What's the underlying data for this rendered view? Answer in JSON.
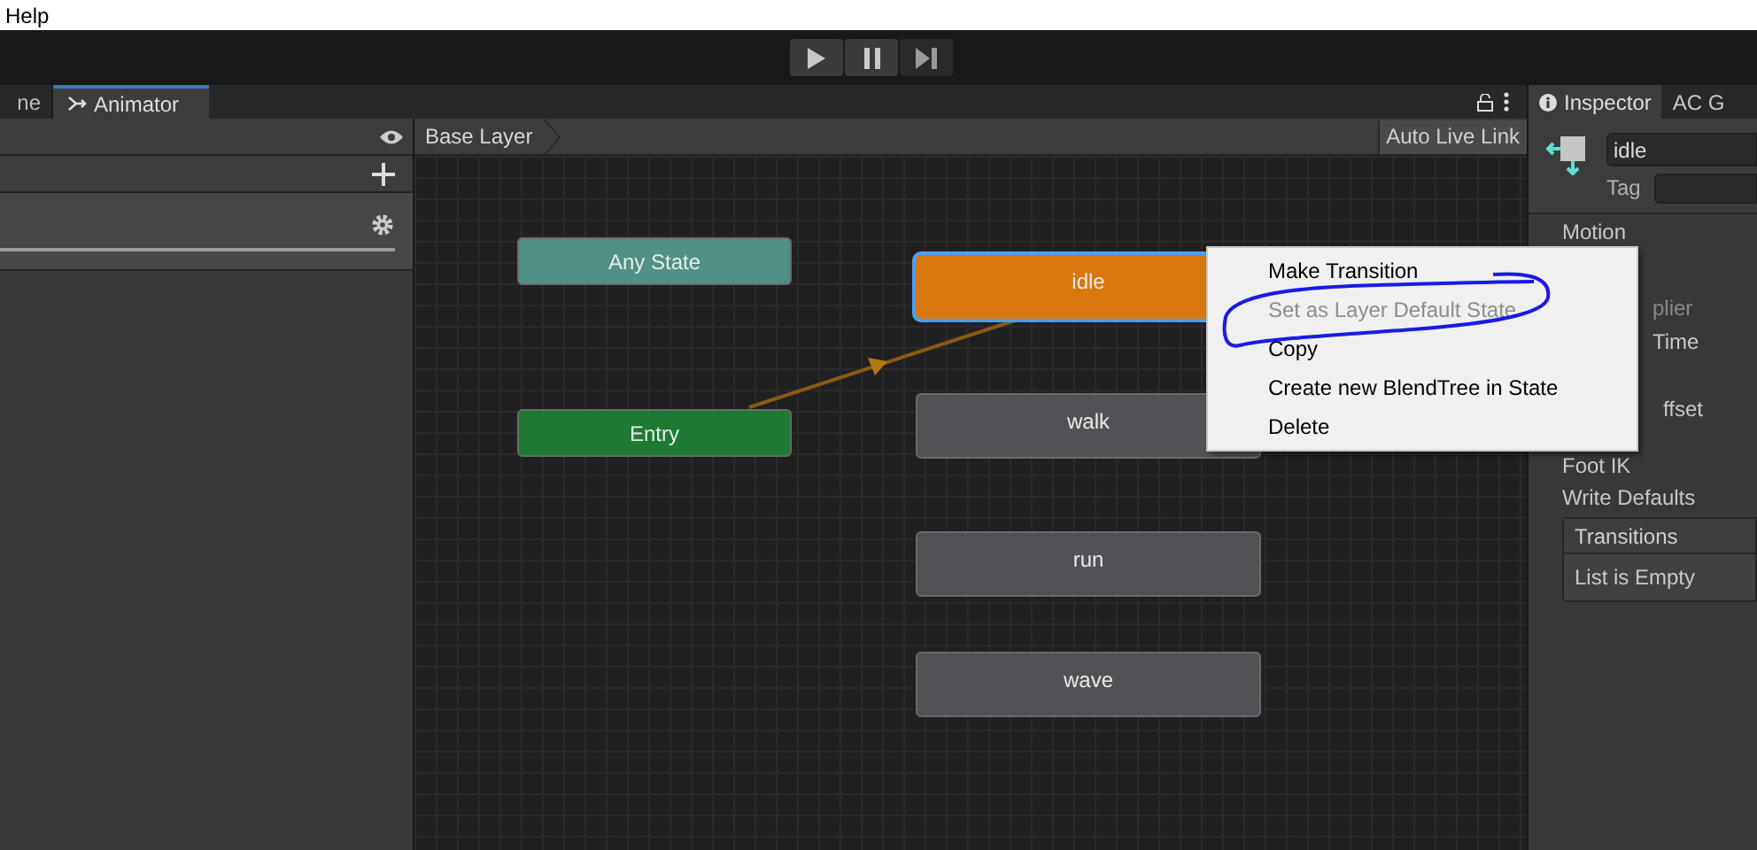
{
  "menu_bar": {
    "items": [
      "Help"
    ]
  },
  "toolbar": {
    "buttons": [
      {
        "kind": "play",
        "on": false
      },
      {
        "kind": "pause",
        "on": false
      },
      {
        "kind": "step",
        "on": false
      }
    ]
  },
  "tabs": [
    {
      "label": "ne",
      "selected": false
    },
    {
      "label": "Animator",
      "selected": true
    }
  ],
  "left_panel": {
    "layer_row": {
      "kind": "layer"
    }
  },
  "breadcrumb": "Base Layer",
  "auto_live_link": {
    "label": "Auto Live Link",
    "on": false
  },
  "nodes": [
    {
      "label": "Any State",
      "kind": "any",
      "selected": false
    },
    {
      "label": "Entry",
      "kind": "entry",
      "selected": false
    },
    {
      "label": "idle",
      "kind": "default",
      "selected": true
    },
    {
      "label": "walk",
      "kind": "state",
      "selected": false
    },
    {
      "label": "run",
      "kind": "state",
      "selected": false
    },
    {
      "label": "wave",
      "kind": "state",
      "selected": false
    }
  ],
  "context_menu": [
    {
      "label": "Make Transition",
      "disabled": false
    },
    {
      "label": "Set as Layer Default State",
      "disabled": true
    },
    {
      "label": "Copy",
      "disabled": false
    },
    {
      "label": "Create new BlendTree in State",
      "disabled": false
    },
    {
      "label": "Delete",
      "disabled": false
    }
  ],
  "inspector": {
    "tabs": [
      {
        "label": "Inspector",
        "selected": true
      },
      {
        "label": "AC G",
        "selected": false
      }
    ],
    "name": "idle",
    "tag_label": "Tag",
    "rows": [
      {
        "label": "Motion",
        "disabled": false
      },
      {
        "label": "plier",
        "disabled": true
      },
      {
        "label": "Time",
        "disabled": false
      },
      {
        "label": "ffset",
        "disabled": false
      },
      {
        "label": "Foot IK",
        "disabled": false
      },
      {
        "label": "Write Defaults",
        "disabled": false
      }
    ],
    "transitions": {
      "title": "Transitions",
      "empty": "List is Empty"
    }
  }
}
